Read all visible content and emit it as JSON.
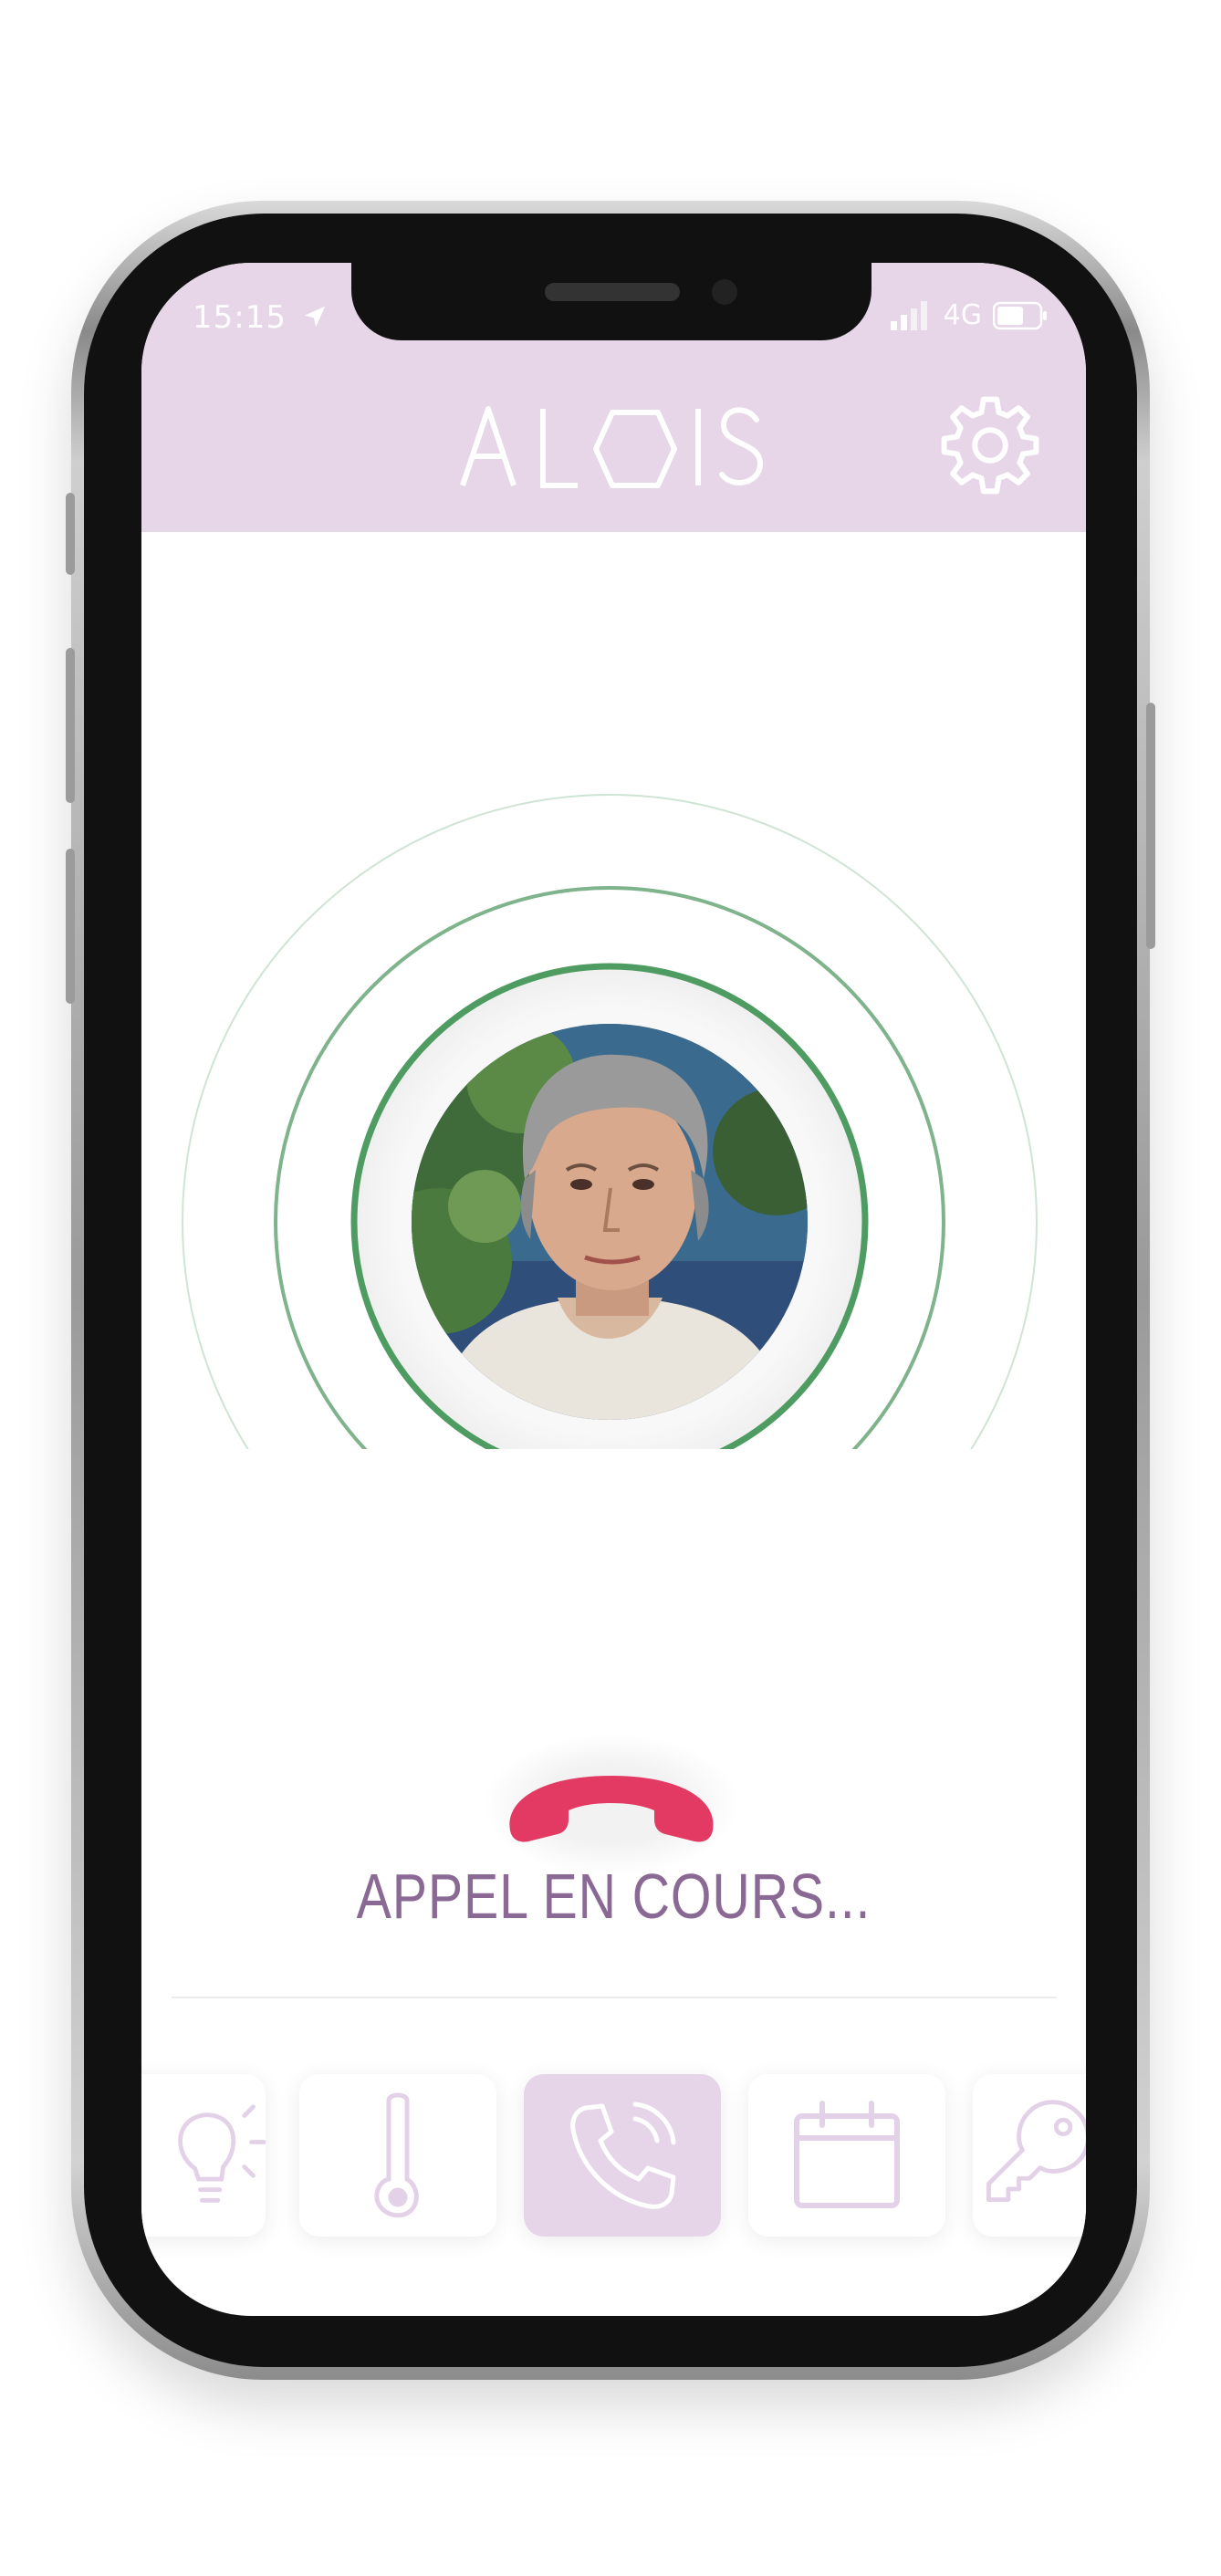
{
  "status_bar": {
    "time": "15:15",
    "network": "4G",
    "icons": [
      "location-arrow-icon",
      "signal-icon",
      "battery-icon"
    ]
  },
  "header": {
    "logo_text": "ALOIS",
    "settings_icon": "gear-icon"
  },
  "call": {
    "status_text": "APPEL EN COURS...",
    "hangup_icon": "phone-hangup-icon",
    "contact_photo": "contact-avatar"
  },
  "tabs": [
    {
      "icon": "lightbulb-icon",
      "active": false
    },
    {
      "icon": "thermometer-icon",
      "active": false
    },
    {
      "icon": "phone-call-icon",
      "active": true
    },
    {
      "icon": "calendar-icon",
      "active": false
    },
    {
      "icon": "key-icon",
      "active": false
    }
  ],
  "colors": {
    "header_bg": "#e6d6e8",
    "accent": "#9a7aa6",
    "ring_green": "#5aa06c",
    "hangup_red": "#e23a63",
    "active_tab_bg": "#e6d5e9"
  }
}
